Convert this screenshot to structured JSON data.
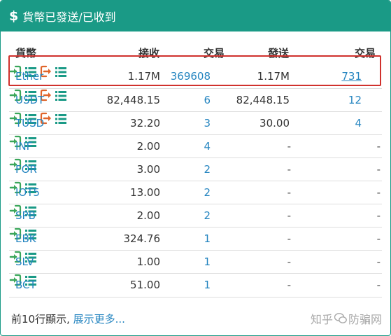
{
  "header": {
    "icon": "dollar-icon",
    "dollar": "$",
    "title": "貨幣已發送/已收到"
  },
  "columns": {
    "currency": "貨幣",
    "received": "接收",
    "tx_in": "交易",
    "sent": "發送",
    "tx_out": "交易"
  },
  "rows": [
    {
      "currency": "Ether",
      "received": "1.17M",
      "tx_in": "369608",
      "sent": "1.17M",
      "tx_out": "731"
    },
    {
      "currency": "USDT",
      "received": "82,448.15",
      "tx_in": "6",
      "sent": "82,448.15",
      "tx_out": "12"
    },
    {
      "currency": "TUSD",
      "received": "32.20",
      "tx_in": "3",
      "sent": "30.00",
      "tx_out": "4"
    },
    {
      "currency": "INF",
      "received": "2.00",
      "tx_in": "4",
      "sent": "-",
      "tx_out": "-"
    },
    {
      "currency": "FOR",
      "received": "3.00",
      "tx_in": "2",
      "sent": "-",
      "tx_out": "-"
    },
    {
      "currency": "IOT5",
      "received": "13.00",
      "tx_in": "2",
      "sent": "-",
      "tx_out": "-"
    },
    {
      "currency": "SPB",
      "received": "2.00",
      "tx_in": "2",
      "sent": "-",
      "tx_out": "-"
    },
    {
      "currency": "EBK",
      "received": "324.76",
      "tx_in": "1",
      "sent": "-",
      "tx_out": "-"
    },
    {
      "currency": "SLV",
      "received": "1.00",
      "tx_in": "1",
      "sent": "-",
      "tx_out": "-"
    },
    {
      "currency": "BCT",
      "received": "51.00",
      "tx_in": "1",
      "sent": "-",
      "tx_out": "-"
    }
  ],
  "footer": {
    "prefix": "前10行顯示,",
    "more_link": "展示更多..."
  },
  "watermark": {
    "left": "知乎",
    "right": "防骗网"
  },
  "colors": {
    "header_bg": "#1a9a86",
    "link": "#2585c0",
    "receive_icon": "#3aa65a",
    "send_icon": "#e0652b",
    "highlight": "#d0312d"
  }
}
